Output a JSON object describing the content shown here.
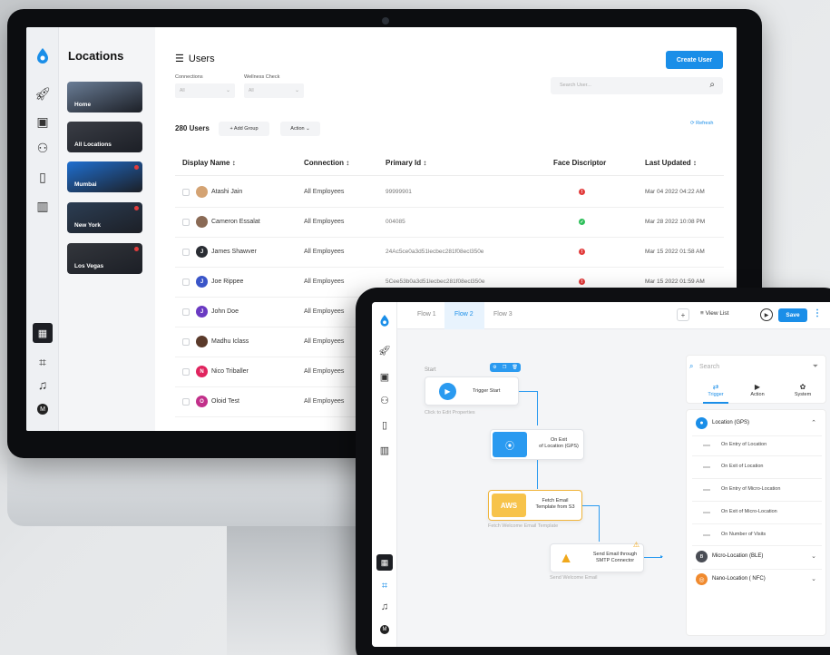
{
  "desktop": {
    "locations": {
      "title": "Locations",
      "cards": [
        {
          "label": "Home",
          "bg": "#6a7d96"
        },
        {
          "label": "All Locations",
          "bg": "#3a3d45"
        },
        {
          "label": "Mumbai",
          "bg": "#1f6fd0"
        },
        {
          "label": "New York",
          "bg": "#2c3e54"
        },
        {
          "label": "Los Vegas",
          "bg": "#33363c"
        }
      ]
    },
    "users": {
      "title": "Users",
      "create_label": "Create User",
      "filters": [
        {
          "label": "Connections",
          "value": "All"
        },
        {
          "label": "Wellness Check",
          "value": "All"
        }
      ],
      "search_placeholder": "Search User...",
      "count": "280 Users",
      "add_group": "+ Add Group",
      "action": "Action",
      "refresh": "⟳ Refresh",
      "columns": [
        "Display Name ↕",
        "Connection ↕",
        "Primary Id ↕",
        "Face Discriptor",
        "Last Updated ↕"
      ],
      "rows": [
        {
          "initial": "",
          "avatar_color": "#d4a373",
          "name": "Atashi Jain",
          "connection": "All Employees",
          "primary_id": "99999901",
          "face": "!",
          "face_color": "#e23c3c",
          "updated": "Mar 04 2022 04:22 AM"
        },
        {
          "initial": "",
          "avatar_color": "#8a6a55",
          "name": "Cameron Essalat",
          "connection": "All Employees",
          "primary_id": "004085",
          "face": "✓",
          "face_color": "#2fbf5b",
          "updated": "Mar 28 2022 10:08 PM"
        },
        {
          "initial": "J",
          "avatar_color": "#2a2d33",
          "name": "James Shawver",
          "connection": "All Employees",
          "primary_id": "24Ac5ce0a3d51lecbec281f08ecl350e",
          "face": "!",
          "face_color": "#e23c3c",
          "updated": "Mar 15 2022 01:58 AM"
        },
        {
          "initial": "J",
          "avatar_color": "#3a55c8",
          "name": "Joe Rippee",
          "connection": "All Employees",
          "primary_id": "5Cee53b0a3d51lecbec281f08ecl350e",
          "face": "!",
          "face_color": "#e23c3c",
          "updated": "Mar 15 2022 01:59 AM"
        },
        {
          "initial": "J",
          "avatar_color": "#6a3ac2",
          "name": "John Doe",
          "connection": "All Employees",
          "primary_id": "",
          "face": "",
          "face_color": "",
          "updated": ""
        },
        {
          "initial": "",
          "avatar_color": "#5a3a2a",
          "name": "Madhu Iclass",
          "connection": "All Employees",
          "primary_id": "",
          "face": "",
          "face_color": "",
          "updated": ""
        },
        {
          "initial": "N",
          "avatar_color": "#e0245e",
          "name": "Nico Triballer",
          "connection": "All Employees",
          "primary_id": "",
          "face": "",
          "face_color": "",
          "updated": ""
        },
        {
          "initial": "O",
          "avatar_color": "#c2308a",
          "name": "Oloid Test",
          "connection": "All Employees",
          "primary_id": "",
          "face": "",
          "face_color": "",
          "updated": ""
        }
      ]
    },
    "rail_avatar": "M"
  },
  "tablet": {
    "tabs": [
      "Flow 1",
      "Flow 2",
      "Flow 3"
    ],
    "active_tab": 1,
    "view_list": "≡ View List",
    "save": "Save",
    "rail_avatar": "M",
    "canvas": {
      "start_label": "Start",
      "trigger_start": "Trigger Start",
      "trigger_hint": "Click to Edit Properties",
      "on_exit": [
        "On Exit",
        "of Location (GPS)"
      ],
      "fetch": [
        "Fetch Email",
        "Template from S3"
      ],
      "fetch_hint": "Fetch Welcome Email Template",
      "aws": "AWS",
      "send": [
        "Send Email through",
        "SMTP Connector"
      ],
      "send_hint": "Send Welcome Email"
    },
    "panel": {
      "search_placeholder": "Search",
      "tabs": [
        {
          "icon": "⇄",
          "label": "Trigger"
        },
        {
          "icon": "▶",
          "label": "Action"
        },
        {
          "icon": "✿",
          "label": "System"
        }
      ],
      "groups": [
        {
          "label": "Location (GPS)",
          "chev": "⌃"
        },
        {
          "label": "Micro-Location (BLE)",
          "chev": "⌄"
        },
        {
          "label": "Nano-Location ( NFC)",
          "chev": "⌄"
        }
      ],
      "items": [
        "On Entry of Location",
        "On Exit of Location",
        "On Entry of Micro-Location",
        "On Exit of Micro-Location",
        "On Number of Visits"
      ]
    }
  },
  "colors": {
    "accent": "#1a8ee8",
    "danger": "#e23c3c",
    "success": "#2fbf5b"
  }
}
